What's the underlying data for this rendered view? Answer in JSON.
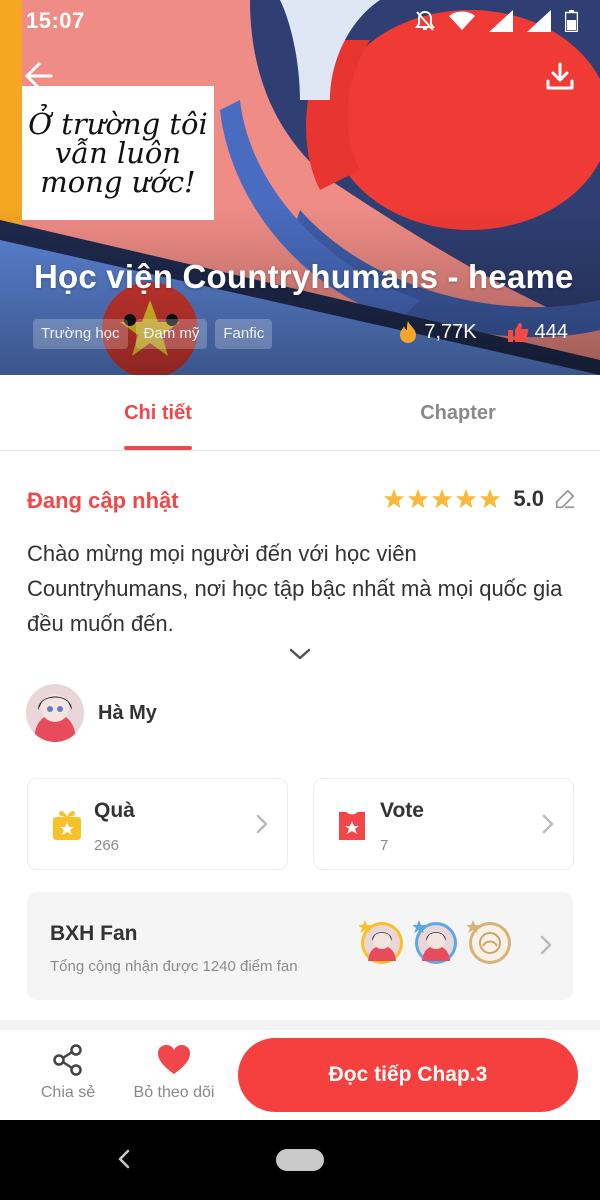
{
  "status_bar": {
    "time": "15:07"
  },
  "hero": {
    "cover_text_lines": [
      "Ở trường tôi",
      "vẫn luôn",
      "mong ước!"
    ],
    "title": "Học viện Countryhumans - heame",
    "tags": [
      "Trường học",
      "Đam mỹ",
      "Fanfic"
    ],
    "views": "7,77K",
    "likes": "444"
  },
  "tabs": {
    "detail": "Chi tiết",
    "chapter": "Chapter"
  },
  "detail": {
    "status": "Đang cập nhật",
    "rating": "5.0",
    "rating_stars": 5,
    "description": "Chào mừng mọi người đến với học viên Countryhumans, nơi học tập bậc nhất mà mọi quốc gia đều muốn đến."
  },
  "author": {
    "name": "Hà My"
  },
  "cards": {
    "gift": {
      "title": "Quà",
      "count": "266"
    },
    "vote": {
      "title": "Vote",
      "count": "7"
    }
  },
  "fan_rank": {
    "title": "BXH Fan",
    "subtitle": "Tổng cộng nhận được 1240 điểm fan"
  },
  "bottom_bar": {
    "share": "Chia sẻ",
    "unfollow": "Bỏ theo dõi",
    "read_button": "Đọc tiếp Chap.3"
  },
  "colors": {
    "accent": "#f2474a",
    "button": "#f6403f",
    "star": "#f8b93c",
    "icon_gold": "#f8c12a"
  }
}
